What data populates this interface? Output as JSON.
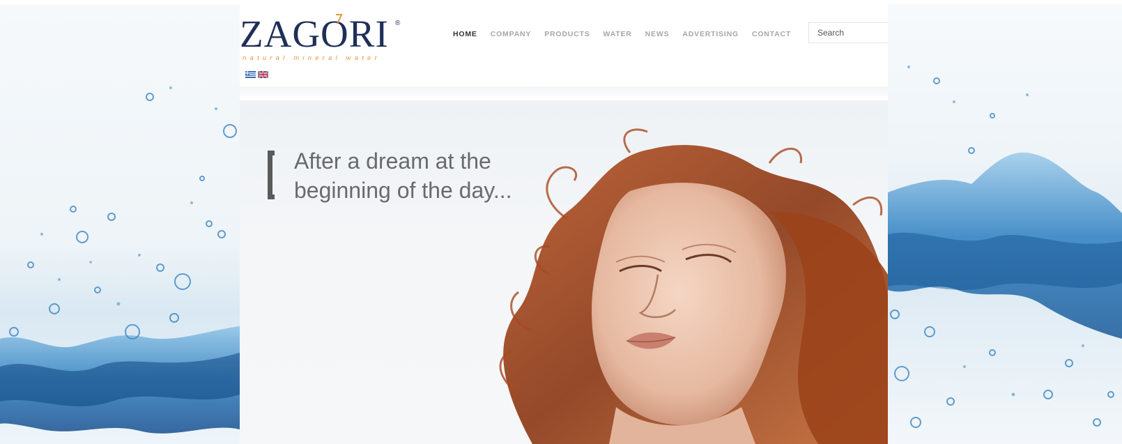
{
  "brand": {
    "name": "ZAGORI",
    "registered": "®",
    "tagline": "natural mineral water",
    "colors": {
      "navy": "#1f2f57",
      "orange": "#e09a3c"
    }
  },
  "languages": [
    {
      "code": "el",
      "icon": "greek-flag-icon"
    },
    {
      "code": "en",
      "icon": "uk-flag-icon"
    }
  ],
  "nav": {
    "items": [
      {
        "label": "HOME",
        "active": true
      },
      {
        "label": "COMPANY",
        "active": false
      },
      {
        "label": "PRODUCTS",
        "active": false
      },
      {
        "label": "WATER",
        "active": false
      },
      {
        "label": "NEWS",
        "active": false
      },
      {
        "label": "ADVERTISING",
        "active": false
      },
      {
        "label": "CONTACT",
        "active": false
      }
    ]
  },
  "search": {
    "placeholder": "Search"
  },
  "hero": {
    "line1": "After a dream at the",
    "line2": "beginning of the day..."
  }
}
